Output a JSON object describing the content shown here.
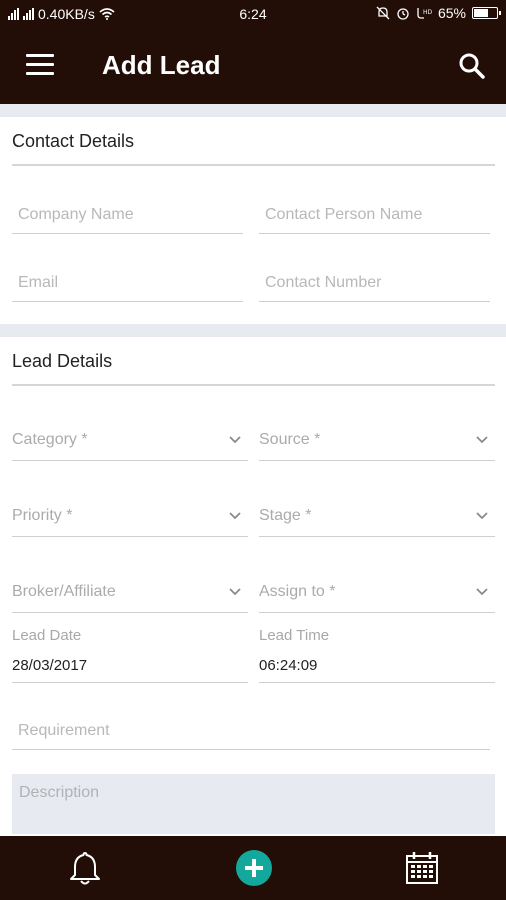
{
  "status_bar": {
    "network_speed": "0.40KB/s",
    "time": "6:24",
    "battery": "65%",
    "battery_level": 0.65,
    "icons": [
      "signal-icon",
      "wifi-icon",
      "silent-icon",
      "alarm-icon",
      "volte-icon",
      "battery-icon"
    ]
  },
  "app_bar": {
    "title": "Add Lead",
    "menu_icon": "hamburger-menu-icon",
    "search_icon": "search-icon"
  },
  "contact_details": {
    "title": "Contact Details",
    "company_name": {
      "placeholder": "Company Name",
      "value": ""
    },
    "contact_person_name": {
      "placeholder": "Contact Person Name",
      "value": ""
    },
    "email": {
      "placeholder": "Email",
      "value": ""
    },
    "contact_number": {
      "placeholder": "Contact Number",
      "value": ""
    }
  },
  "lead_details": {
    "title": "Lead Details",
    "category": {
      "placeholder": "Category *"
    },
    "source": {
      "placeholder": "Source *"
    },
    "priority": {
      "placeholder": "Priority *"
    },
    "stage": {
      "placeholder": "Stage *"
    },
    "broker": {
      "placeholder": "Broker/Affiliate"
    },
    "assign_to": {
      "placeholder": "Assign to *"
    },
    "lead_date": {
      "label": "Lead Date",
      "value": "28/03/2017"
    },
    "lead_time": {
      "label": "Lead Time",
      "value": "06:24:09"
    },
    "requirement": {
      "placeholder": "Requirement",
      "value": ""
    },
    "description": {
      "placeholder": "Description",
      "value": ""
    }
  },
  "bottom_nav": {
    "items": [
      "notifications-bell-icon",
      "add-icon",
      "calendar-icon"
    ]
  },
  "colors": {
    "primary_dark": "#220e06",
    "accent": "#13a89b",
    "section_strip": "#e8eaf1"
  }
}
